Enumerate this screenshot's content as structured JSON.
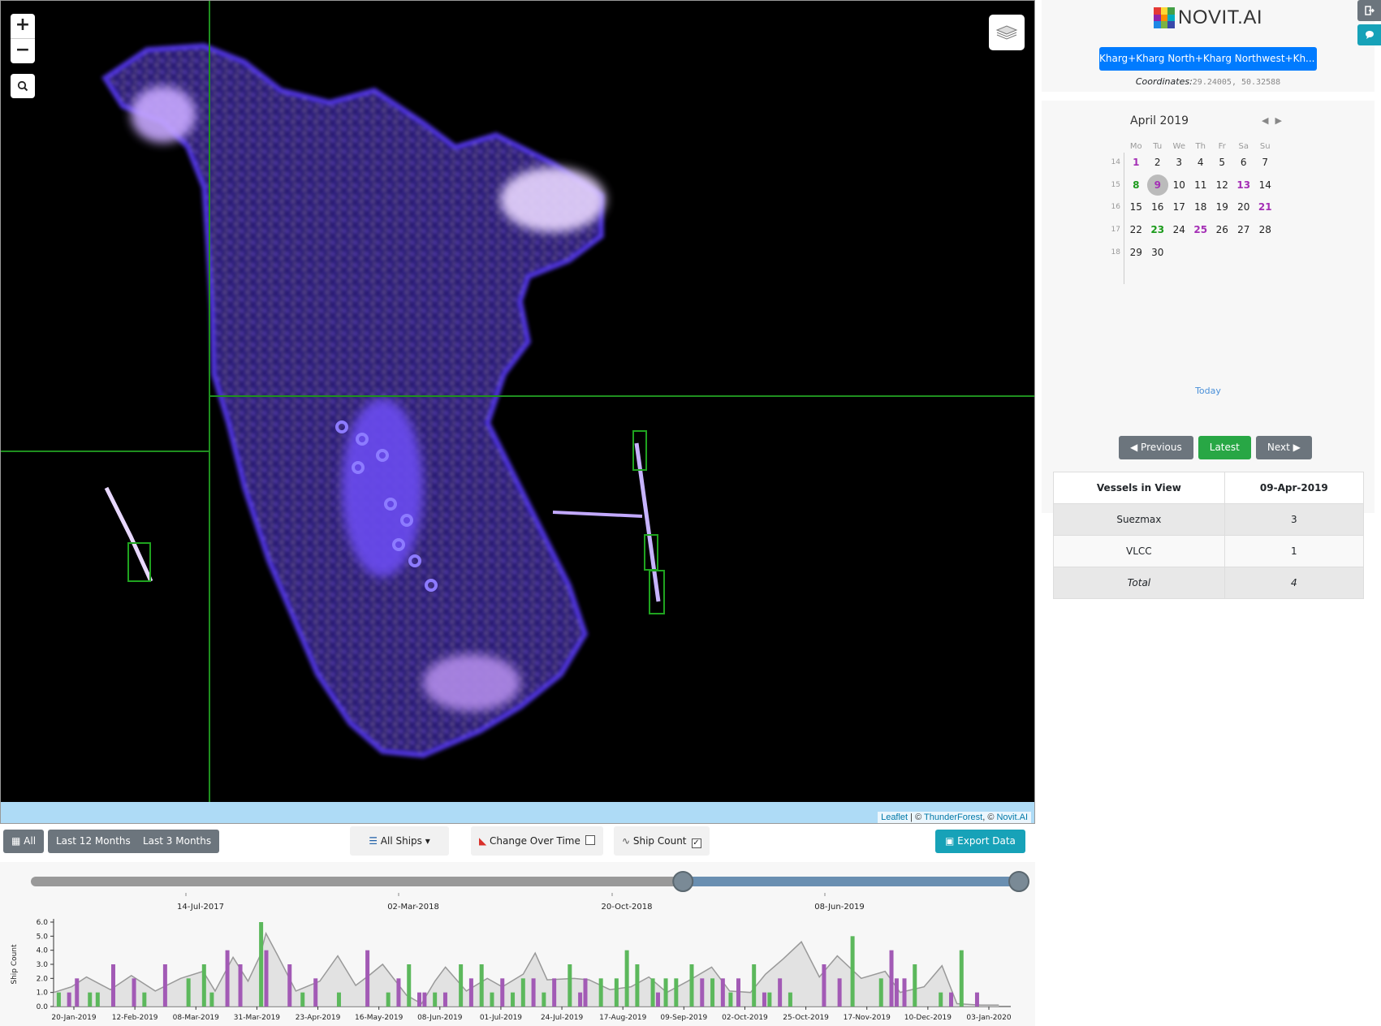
{
  "map": {
    "zoom_in": "+",
    "zoom_out": "−",
    "attribution": {
      "leaflet": "Leaflet",
      "sep1": " | © ",
      "thunderforest": "ThunderForest",
      "sep2": ", © ",
      "novit": "Novit.AI"
    }
  },
  "header": {
    "logo_text": "NOVIT.AI",
    "aoi_dropdown": "Kharg+Kharg North+Kharg Northwest+Kh...",
    "coordinates_label": "Coordinates:",
    "coordinates_value": "29.24005, 50.32588"
  },
  "calendar": {
    "month": "April 2019",
    "weekdays": [
      "Mo",
      "Tu",
      "We",
      "Th",
      "Fr",
      "Sa",
      "Su"
    ],
    "weeks": [
      {
        "wk": "14",
        "days": [
          {
            "d": "1",
            "s": "p"
          },
          {
            "d": "2"
          },
          {
            "d": "3"
          },
          {
            "d": "4"
          },
          {
            "d": "5"
          },
          {
            "d": "6"
          },
          {
            "d": "7"
          }
        ]
      },
      {
        "wk": "15",
        "days": [
          {
            "d": "8",
            "s": "g"
          },
          {
            "d": "9",
            "s": "sel"
          },
          {
            "d": "10"
          },
          {
            "d": "11"
          },
          {
            "d": "12"
          },
          {
            "d": "13",
            "s": "p"
          },
          {
            "d": "14"
          }
        ]
      },
      {
        "wk": "16",
        "days": [
          {
            "d": "15"
          },
          {
            "d": "16"
          },
          {
            "d": "17"
          },
          {
            "d": "18"
          },
          {
            "d": "19"
          },
          {
            "d": "20"
          },
          {
            "d": "21",
            "s": "p"
          }
        ]
      },
      {
        "wk": "17",
        "days": [
          {
            "d": "22"
          },
          {
            "d": "23",
            "s": "g"
          },
          {
            "d": "24"
          },
          {
            "d": "25",
            "s": "p"
          },
          {
            "d": "26"
          },
          {
            "d": "27"
          },
          {
            "d": "28"
          }
        ]
      },
      {
        "wk": "18",
        "days": [
          {
            "d": "29"
          },
          {
            "d": "30"
          }
        ]
      }
    ],
    "today_label": "Today"
  },
  "nav": {
    "previous": "Previous",
    "latest": "Latest",
    "next": "Next"
  },
  "vessels": {
    "header_left": "Vessels in View",
    "header_right": "09-Apr-2019",
    "rows": [
      {
        "type": "Suezmax",
        "count": "3"
      },
      {
        "type": "VLCC",
        "count": "1"
      }
    ],
    "total_label": "Total",
    "total_value": "4"
  },
  "toolbar": {
    "all": "All",
    "last12": "Last 12 Months",
    "last3": "Last 3 Months",
    "all_ships": "All Ships",
    "change_over_time": "Change Over Time",
    "ship_count": "Ship Count",
    "export": "Export Data"
  },
  "timeline": {
    "slider_dates": [
      "14-Jul-2017",
      "02-Mar-2018",
      "20-Oct-2018",
      "08-Jun-2019"
    ],
    "range_start_fraction": 0.66,
    "range_end_fraction": 1.0
  },
  "chart_data": {
    "type": "bar",
    "ylabel": "Ship Count",
    "ylim": [
      0,
      6.0
    ],
    "yticks": [
      "0.0",
      "1.0",
      "2.0",
      "3.0",
      "4.0",
      "5.0",
      "6.0"
    ],
    "xtick_labels": [
      "20-Jan-2019",
      "12-Feb-2019",
      "08-Mar-2019",
      "31-Mar-2019",
      "23-Apr-2019",
      "16-May-2019",
      "08-Jun-2019",
      "01-Jul-2019",
      "24-Jul-2019",
      "17-Aug-2019",
      "09-Sep-2019",
      "02-Oct-2019",
      "25-Oct-2019",
      "17-Nov-2019",
      "10-Dec-2019",
      "03-Jan-2020"
    ],
    "x_domain": [
      "2019-01-08",
      "2020-01-12"
    ],
    "series": [
      {
        "name": "green",
        "color": "#5cb85c",
        "points": [
          [
            "2019-01-10",
            1
          ],
          [
            "2019-01-22",
            1
          ],
          [
            "2019-01-25",
            1
          ],
          [
            "2019-02-12",
            1
          ],
          [
            "2019-03-01",
            2
          ],
          [
            "2019-03-07",
            3
          ],
          [
            "2019-03-10",
            1
          ],
          [
            "2019-03-29",
            6
          ],
          [
            "2019-04-14",
            1
          ],
          [
            "2019-04-28",
            1
          ],
          [
            "2019-05-17",
            1
          ],
          [
            "2019-05-25",
            3
          ],
          [
            "2019-06-04",
            1
          ],
          [
            "2019-06-14",
            3
          ],
          [
            "2019-06-22",
            3
          ],
          [
            "2019-06-26",
            1
          ],
          [
            "2019-07-04",
            1
          ],
          [
            "2019-07-08",
            2
          ],
          [
            "2019-07-16",
            1
          ],
          [
            "2019-07-26",
            3
          ],
          [
            "2019-08-07",
            2
          ],
          [
            "2019-08-13",
            2
          ],
          [
            "2019-08-17",
            4
          ],
          [
            "2019-08-21",
            3
          ],
          [
            "2019-08-27",
            2
          ],
          [
            "2019-09-01",
            2
          ],
          [
            "2019-09-05",
            2
          ],
          [
            "2019-09-11",
            3
          ],
          [
            "2019-09-19",
            2
          ],
          [
            "2019-09-26",
            1
          ],
          [
            "2019-10-05",
            3
          ],
          [
            "2019-10-11",
            1
          ],
          [
            "2019-10-19",
            1
          ],
          [
            "2019-11-12",
            5
          ],
          [
            "2019-11-23",
            2
          ],
          [
            "2019-12-06",
            3
          ],
          [
            "2019-12-16",
            1
          ],
          [
            "2019-12-24",
            4
          ]
        ]
      },
      {
        "name": "purple",
        "color": "#a25ab5",
        "points": [
          [
            "2019-01-14",
            1
          ],
          [
            "2019-01-17",
            2
          ],
          [
            "2019-01-31",
            3
          ],
          [
            "2019-02-08",
            2
          ],
          [
            "2019-02-20",
            3
          ],
          [
            "2019-03-16",
            4
          ],
          [
            "2019-03-21",
            3
          ],
          [
            "2019-03-31",
            4
          ],
          [
            "2019-04-09",
            3
          ],
          [
            "2019-04-19",
            2
          ],
          [
            "2019-05-09",
            4
          ],
          [
            "2019-05-21",
            2
          ],
          [
            "2019-05-29",
            1
          ],
          [
            "2019-05-31",
            1
          ],
          [
            "2019-06-08",
            1
          ],
          [
            "2019-06-18",
            2
          ],
          [
            "2019-06-30",
            2
          ],
          [
            "2019-07-12",
            2
          ],
          [
            "2019-07-20",
            2
          ],
          [
            "2019-07-30",
            1
          ],
          [
            "2019-08-01",
            2
          ],
          [
            "2019-08-29",
            1
          ],
          [
            "2019-09-15",
            2
          ],
          [
            "2019-09-23",
            2
          ],
          [
            "2019-09-29",
            2
          ],
          [
            "2019-10-09",
            1
          ],
          [
            "2019-10-15",
            2
          ],
          [
            "2019-11-01",
            3
          ],
          [
            "2019-11-07",
            2
          ],
          [
            "2019-11-27",
            4
          ],
          [
            "2019-11-29",
            2
          ],
          [
            "2019-12-02",
            2
          ],
          [
            "2019-12-20",
            1
          ],
          [
            "2019-12-30",
            1
          ]
        ]
      }
    ],
    "trend": [
      [
        0,
        1
      ],
      [
        12,
        1.4
      ],
      [
        22,
        2.1
      ],
      [
        38,
        1.2
      ],
      [
        52,
        2.2
      ],
      [
        68,
        1.1
      ],
      [
        85,
        2.0
      ],
      [
        100,
        2.5
      ],
      [
        108,
        1.1
      ],
      [
        120,
        3.5
      ],
      [
        130,
        1.8
      ],
      [
        138,
        3.6
      ],
      [
        142,
        5.2
      ],
      [
        150,
        3.6
      ],
      [
        162,
        1.1
      ],
      [
        178,
        1.8
      ],
      [
        190,
        3.6
      ],
      [
        202,
        1.5
      ],
      [
        212,
        2.3
      ],
      [
        220,
        3.0
      ],
      [
        236,
        0.8
      ],
      [
        246,
        0.2
      ],
      [
        255,
        1.8
      ],
      [
        262,
        2.8
      ],
      [
        276,
        1.1
      ],
      [
        290,
        2.0
      ],
      [
        300,
        1.4
      ],
      [
        314,
        2.3
      ],
      [
        322,
        3.8
      ],
      [
        330,
        1.9
      ],
      [
        348,
        2.0
      ],
      [
        358,
        1.9
      ],
      [
        372,
        1.2
      ],
      [
        386,
        1.4
      ],
      [
        398,
        2.1
      ],
      [
        410,
        1.0
      ],
      [
        424,
        1.8
      ],
      [
        440,
        2.8
      ],
      [
        452,
        1.1
      ],
      [
        466,
        1.0
      ],
      [
        476,
        2.3
      ],
      [
        488,
        3.4
      ],
      [
        500,
        4.6
      ],
      [
        512,
        2.1
      ],
      [
        524,
        3.6
      ],
      [
        540,
        2.0
      ],
      [
        556,
        2.5
      ],
      [
        566,
        1.0
      ],
      [
        582,
        1.4
      ],
      [
        594,
        2.9
      ],
      [
        604,
        0.2
      ],
      [
        620,
        0.1
      ],
      [
        632,
        0.1
      ]
    ]
  },
  "colors": {
    "primary": "#007bff",
    "secondary": "#6c757d",
    "success": "#28a745",
    "info": "#17a2b8",
    "grid_line": "#1f8f1f",
    "detection_box": "#1fa31f"
  }
}
